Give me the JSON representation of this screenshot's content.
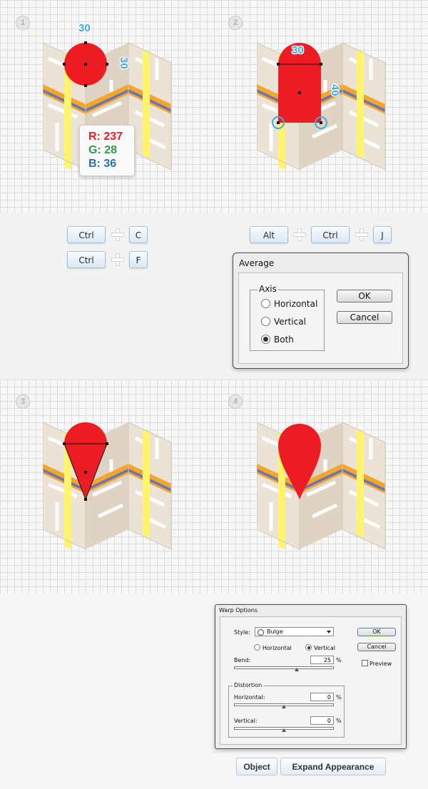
{
  "colors": {
    "pin_red": "#ed1c24",
    "label_blue": "#3ea9e6",
    "map_orange": "#f3a72a",
    "map_blue_stripe": "#6a74b8",
    "map_yellow": "#fff46b"
  },
  "steps": {
    "step1": {
      "number": "1",
      "circle_width_label": "30",
      "circle_height_label": "30",
      "rgb": {
        "r": "R: 237",
        "g": "G: 28",
        "b": "B: 36"
      }
    },
    "step2": {
      "number": "2",
      "width_label": "30",
      "height_label": "40"
    },
    "step3": {
      "number": "3"
    },
    "step4": {
      "number": "4"
    }
  },
  "shortcuts": {
    "copy": [
      "Ctrl",
      "C"
    ],
    "paste_front": [
      "Ctrl",
      "F"
    ],
    "average": [
      "Alt",
      "Ctrl",
      "J"
    ]
  },
  "average_dialog": {
    "title": "Average",
    "group_label": "Axis",
    "options": [
      {
        "label": "Horizontal",
        "selected": false
      },
      {
        "label": "Vertical",
        "selected": false
      },
      {
        "label": "Both",
        "selected": true
      }
    ],
    "ok_label": "OK",
    "cancel_label": "Cancel"
  },
  "warp_dialog": {
    "title": "Warp Options",
    "style_label": "Style:",
    "style_value": "Bulge",
    "orientation_options": [
      {
        "label": "Horizontal",
        "selected": false
      },
      {
        "label": "Vertical",
        "selected": true
      }
    ],
    "bend_label": "Bend:",
    "bend_value": "25",
    "bend_percent": 62.5,
    "percent_sign": "%",
    "distortion_label": "Distortion",
    "horizontal_label": "Horizontal:",
    "horizontal_value": "0",
    "vertical_label": "Vertical:",
    "vertical_value": "0",
    "ok_label": "OK",
    "cancel_label": "Cancel",
    "preview_label": "Preview",
    "preview_checked": false
  },
  "bottom_buttons": {
    "object": "Object",
    "expand": "Expand Appearance"
  }
}
